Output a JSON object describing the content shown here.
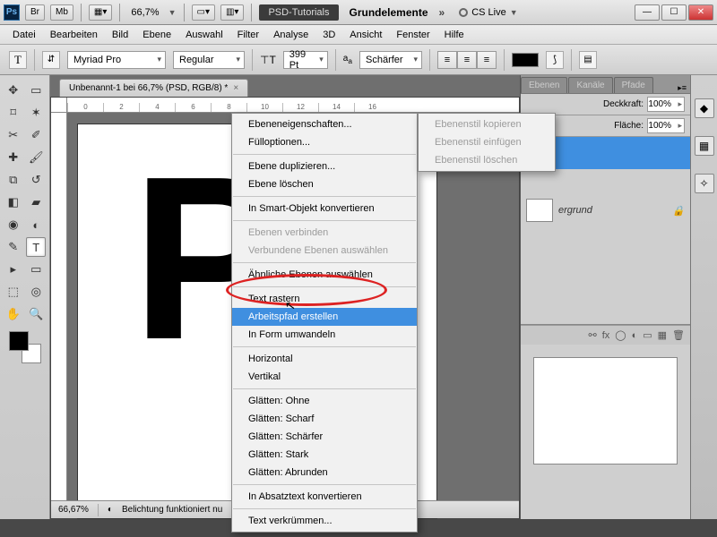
{
  "titlebar": {
    "zoom": "66,7%",
    "workspace_label": "PSD-Tutorials",
    "doc_name": "Grundelemente",
    "cslive": "CS Live"
  },
  "menubar": [
    "Datei",
    "Bearbeiten",
    "Bild",
    "Ebene",
    "Auswahl",
    "Filter",
    "Analyse",
    "3D",
    "Ansicht",
    "Fenster",
    "Hilfe"
  ],
  "optbar": {
    "font_family": "Myriad Pro",
    "font_style": "Regular",
    "font_size": "399 Pt",
    "aa_label": "Schärfer"
  },
  "doctab": {
    "label": "Unbenannt-1 bei 66,7% (PSD, RGB/8) *"
  },
  "ruler_marks": [
    "0",
    "2",
    "4",
    "6",
    "8",
    "10",
    "12",
    "14",
    "16"
  ],
  "canvas_text": "P",
  "statusbar": {
    "zoom": "66,67%",
    "info": "Belichtung funktioniert nu"
  },
  "panels": {
    "tabs": [
      "Ebenen",
      "Kanäle",
      "Pfade"
    ],
    "opacity_label": "Deckkraft:",
    "opacity_value": "100%",
    "fill_label": "Fläche:",
    "fill_value": "100%",
    "layers": [
      {
        "name": "",
        "selected": true
      },
      {
        "name": "ergrund",
        "bg": true
      }
    ]
  },
  "context_menu_1": [
    {
      "t": "Ebeneneigenschaften..."
    },
    {
      "t": "Fülloptionen..."
    },
    {
      "sep": true
    },
    {
      "t": "Ebene duplizieren..."
    },
    {
      "t": "Ebene löschen"
    },
    {
      "sep": true
    },
    {
      "t": "In Smart-Objekt konvertieren"
    },
    {
      "sep": true
    },
    {
      "t": "Ebenen verbinden",
      "dis": true
    },
    {
      "t": "Verbundene Ebenen auswählen",
      "dis": true
    },
    {
      "sep": true
    },
    {
      "t": "Ähnliche Ebenen auswählen"
    },
    {
      "sep": true
    },
    {
      "t": "Text rastern"
    },
    {
      "t": "Arbeitspfad erstellen",
      "hl": true
    },
    {
      "t": "In Form umwandeln"
    },
    {
      "sep": true
    },
    {
      "t": "Horizontal"
    },
    {
      "t": "Vertikal"
    },
    {
      "sep": true
    },
    {
      "t": "Glätten: Ohne"
    },
    {
      "t": "Glätten: Scharf"
    },
    {
      "t": "Glätten: Schärfer"
    },
    {
      "t": "Glätten: Stark"
    },
    {
      "t": "Glätten: Abrunden"
    },
    {
      "sep": true
    },
    {
      "t": "In Absatztext konvertieren"
    },
    {
      "sep": true
    },
    {
      "t": "Text verkrümmen..."
    }
  ],
  "context_menu_2": [
    {
      "t": "Ebenenstil kopieren",
      "dis": true
    },
    {
      "t": "Ebenenstil einfügen",
      "dis": true
    },
    {
      "t": "Ebenenstil löschen",
      "dis": true
    }
  ]
}
